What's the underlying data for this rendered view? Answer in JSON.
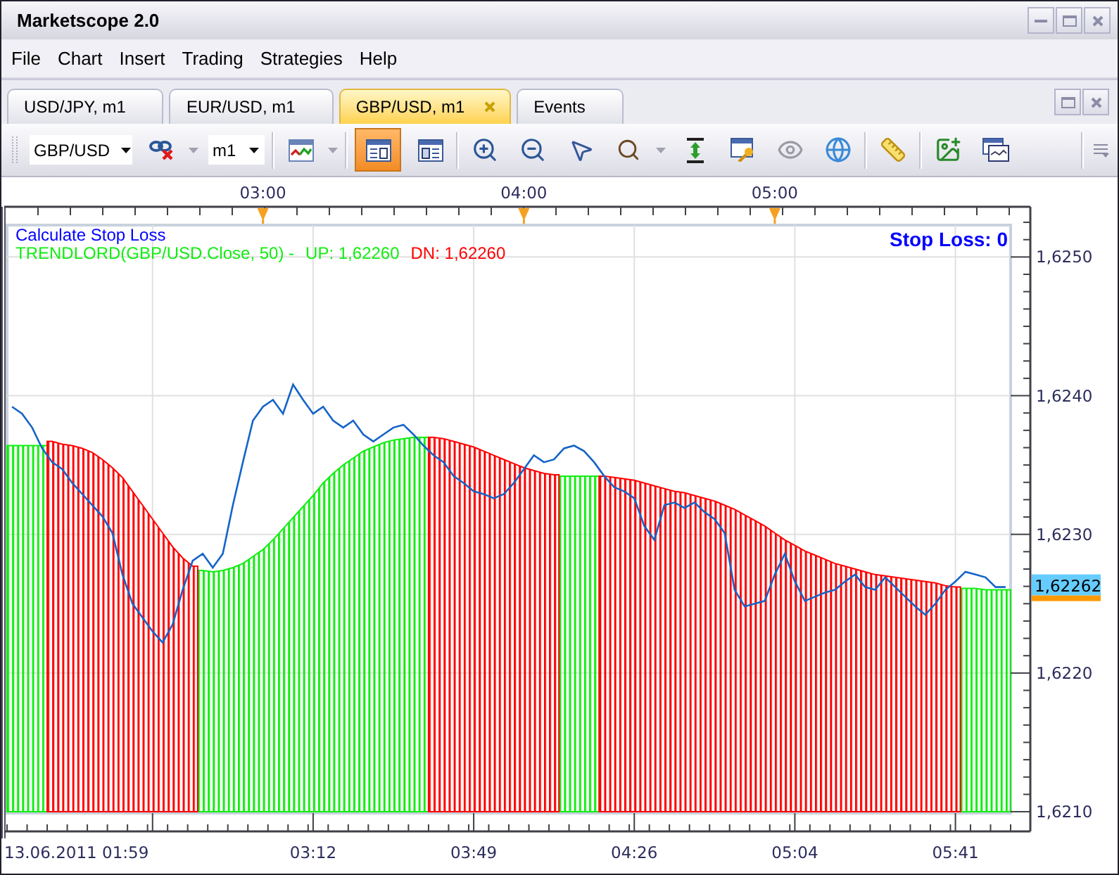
{
  "window": {
    "title": "Marketscope 2.0"
  },
  "menu": [
    "File",
    "Chart",
    "Insert",
    "Trading",
    "Strategies",
    "Help"
  ],
  "tabs": [
    {
      "label": "USD/JPY, m1",
      "selected": false
    },
    {
      "label": "EUR/USD, m1",
      "selected": false
    },
    {
      "label": "GBP/USD, m1",
      "selected": true
    },
    {
      "label": "Events",
      "selected": false
    }
  ],
  "toolbar": {
    "groups": [
      [
        {
          "kind": "combo",
          "value": "GBP/USD"
        },
        {
          "kind": "button",
          "selected": false,
          "dropdown": true
        },
        {
          "kind": "combo",
          "value": "m1"
        }
      ],
      [
        {
          "kind": "button",
          "selected": false,
          "dropdown": true
        }
      ],
      [
        {
          "kind": "button",
          "selected": true,
          "dropdown": false
        },
        {
          "kind": "button",
          "selected": false,
          "dropdown": false
        }
      ],
      [
        {
          "kind": "button",
          "selected": false,
          "dropdown": false
        },
        {
          "kind": "button",
          "selected": false,
          "dropdown": false
        },
        {
          "kind": "button",
          "selected": false,
          "dropdown": false
        },
        {
          "kind": "button",
          "selected": false,
          "dropdown": true
        },
        {
          "kind": "button",
          "selected": false,
          "dropdown": false
        },
        {
          "kind": "button",
          "selected": false,
          "dropdown": false
        },
        {
          "kind": "button",
          "selected": false,
          "dropdown": false
        },
        {
          "kind": "button",
          "selected": false,
          "dropdown": false
        }
      ],
      [
        {
          "kind": "button",
          "selected": false,
          "dropdown": false
        }
      ],
      [
        {
          "kind": "button",
          "selected": false,
          "dropdown": false
        },
        {
          "kind": "button",
          "selected": false,
          "dropdown": false
        }
      ]
    ]
  },
  "chart": {
    "title": "Calculate Stop Loss",
    "indicator": "TRENDLORD(GBP/USD.Close, 50) -",
    "up_reading": "UP: 1,62260",
    "dn_reading": "DN: 1,62260",
    "stop_loss": "Stop Loss: 0",
    "current_price": "1,62262",
    "top_time_labels": [
      "03:00",
      "04:00",
      "05:00"
    ],
    "price_labels": [
      "1,6250",
      "1,6240",
      "1,6230",
      "1,6220",
      "1,6210"
    ],
    "time_labels": [
      "13.06.2011 01:59",
      "03:12",
      "03:49",
      "04:26",
      "05:04",
      "05:41"
    ]
  }
}
